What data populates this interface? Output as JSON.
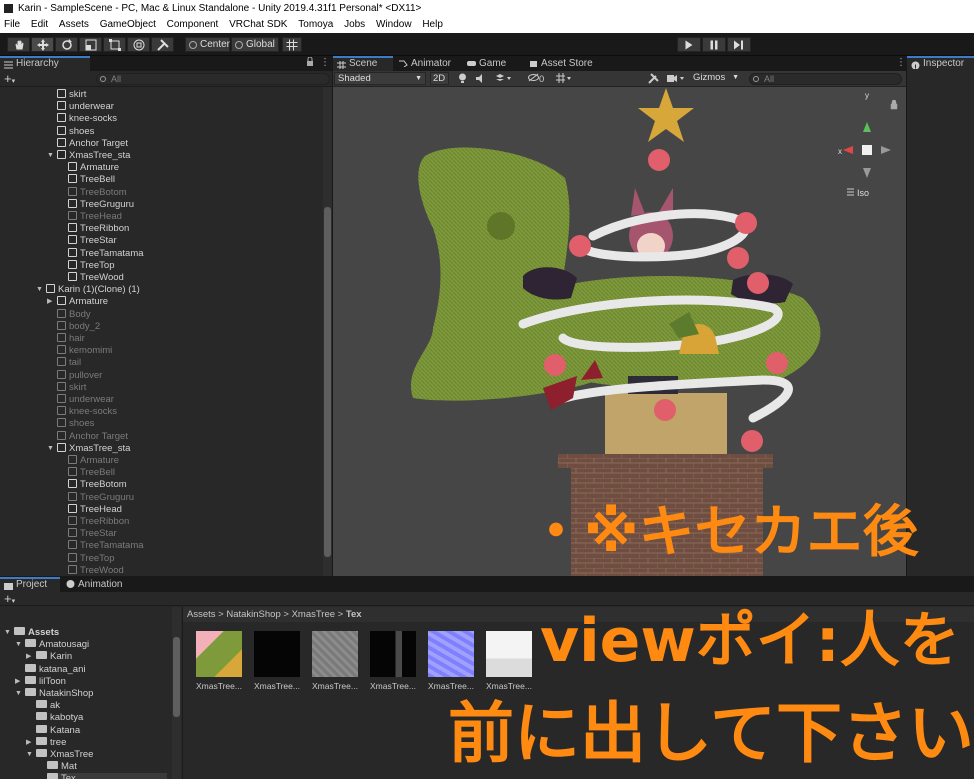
{
  "window": {
    "title": "Karin - SampleScene - PC, Mac & Linux Standalone - Unity 2019.4.31f1 Personal* <DX11>"
  },
  "menu": [
    "File",
    "Edit",
    "Assets",
    "GameObject",
    "Component",
    "VRChat SDK",
    "Tomoya",
    "Jobs",
    "Window",
    "Help"
  ],
  "toolbar": {
    "pivot": "Center",
    "space": "Global"
  },
  "hierarchy": {
    "tab": "Hierarchy",
    "search_placeholder": "All",
    "rows": [
      {
        "label": "skirt",
        "indent": 1,
        "dim": false,
        "arrow": ""
      },
      {
        "label": "underwear",
        "indent": 1,
        "dim": false,
        "arrow": ""
      },
      {
        "label": "knee-socks",
        "indent": 1,
        "dim": false,
        "arrow": ""
      },
      {
        "label": "shoes",
        "indent": 1,
        "dim": false,
        "arrow": ""
      },
      {
        "label": "Anchor Target",
        "indent": 1,
        "dim": false,
        "arrow": ""
      },
      {
        "label": "XmasTree_sta",
        "indent": 1,
        "dim": false,
        "arrow": "▼"
      },
      {
        "label": "Armature",
        "indent": 2,
        "dim": false,
        "arrow": ""
      },
      {
        "label": "TreeBell",
        "indent": 2,
        "dim": false,
        "arrow": ""
      },
      {
        "label": "TreeBotom",
        "indent": 2,
        "dim": true,
        "arrow": ""
      },
      {
        "label": "TreeGruguru",
        "indent": 2,
        "dim": false,
        "arrow": ""
      },
      {
        "label": "TreeHead",
        "indent": 2,
        "dim": true,
        "arrow": ""
      },
      {
        "label": "TreeRibbon",
        "indent": 2,
        "dim": false,
        "arrow": ""
      },
      {
        "label": "TreeStar",
        "indent": 2,
        "dim": false,
        "arrow": ""
      },
      {
        "label": "TreeTamatama",
        "indent": 2,
        "dim": false,
        "arrow": ""
      },
      {
        "label": "TreeTop",
        "indent": 2,
        "dim": false,
        "arrow": ""
      },
      {
        "label": "TreeWood",
        "indent": 2,
        "dim": false,
        "arrow": ""
      },
      {
        "label": "Karin (1)(Clone) (1)",
        "indent": 0,
        "dim": false,
        "arrow": "▼"
      },
      {
        "label": "Armature",
        "indent": 1,
        "dim": false,
        "arrow": "▶"
      },
      {
        "label": "Body",
        "indent": 1,
        "dim": true,
        "arrow": ""
      },
      {
        "label": "body_2",
        "indent": 1,
        "dim": true,
        "arrow": ""
      },
      {
        "label": "hair",
        "indent": 1,
        "dim": true,
        "arrow": ""
      },
      {
        "label": "kemomimi",
        "indent": 1,
        "dim": true,
        "arrow": ""
      },
      {
        "label": "tail",
        "indent": 1,
        "dim": true,
        "arrow": ""
      },
      {
        "label": "pullover",
        "indent": 1,
        "dim": true,
        "arrow": ""
      },
      {
        "label": "skirt",
        "indent": 1,
        "dim": true,
        "arrow": ""
      },
      {
        "label": "underwear",
        "indent": 1,
        "dim": true,
        "arrow": ""
      },
      {
        "label": "knee-socks",
        "indent": 1,
        "dim": true,
        "arrow": ""
      },
      {
        "label": "shoes",
        "indent": 1,
        "dim": true,
        "arrow": ""
      },
      {
        "label": "Anchor Target",
        "indent": 1,
        "dim": true,
        "arrow": ""
      },
      {
        "label": "XmasTree_sta",
        "indent": 1,
        "dim": false,
        "arrow": "▼"
      },
      {
        "label": "Armature",
        "indent": 2,
        "dim": true,
        "arrow": ""
      },
      {
        "label": "TreeBell",
        "indent": 2,
        "dim": true,
        "arrow": ""
      },
      {
        "label": "TreeBotom",
        "indent": 2,
        "dim": false,
        "arrow": ""
      },
      {
        "label": "TreeGruguru",
        "indent": 2,
        "dim": true,
        "arrow": ""
      },
      {
        "label": "TreeHead",
        "indent": 2,
        "dim": false,
        "arrow": ""
      },
      {
        "label": "TreeRibbon",
        "indent": 2,
        "dim": true,
        "arrow": ""
      },
      {
        "label": "TreeStar",
        "indent": 2,
        "dim": true,
        "arrow": ""
      },
      {
        "label": "TreeTamatama",
        "indent": 2,
        "dim": true,
        "arrow": ""
      },
      {
        "label": "TreeTop",
        "indent": 2,
        "dim": true,
        "arrow": ""
      },
      {
        "label": "TreeWood",
        "indent": 2,
        "dim": true,
        "arrow": ""
      }
    ]
  },
  "scene_tabs": [
    "Scene",
    "Animator",
    "Game",
    "Asset Store"
  ],
  "scene_toolbar": {
    "shading": "Shaded",
    "mode_2d": "2D",
    "hidden_count": "0",
    "gizmos": "Gizmos",
    "search_placeholder": "All",
    "projection": "Iso"
  },
  "inspector": {
    "tab": "Inspector"
  },
  "project": {
    "tabs": [
      "Project",
      "Animation"
    ],
    "breadcrumb": [
      "Assets",
      "NatakinShop",
      "XmasTree",
      "Tex"
    ],
    "tree": [
      {
        "label": "Assets",
        "indent": 0,
        "arrow": "▼",
        "bold": true
      },
      {
        "label": "Amatousagi",
        "indent": 1,
        "arrow": "▼",
        "bold": false
      },
      {
        "label": "Karin",
        "indent": 2,
        "arrow": "▶",
        "bold": false
      },
      {
        "label": "katana_ani",
        "indent": 1,
        "arrow": "",
        "bold": false
      },
      {
        "label": "lilToon",
        "indent": 1,
        "arrow": "▶",
        "bold": false
      },
      {
        "label": "NatakinShop",
        "indent": 1,
        "arrow": "▼",
        "bold": false
      },
      {
        "label": "ak",
        "indent": 2,
        "arrow": "",
        "bold": false
      },
      {
        "label": "kabotya",
        "indent": 2,
        "arrow": "",
        "bold": false
      },
      {
        "label": "Katana",
        "indent": 2,
        "arrow": "",
        "bold": false
      },
      {
        "label": "tree",
        "indent": 2,
        "arrow": "▶",
        "bold": false
      },
      {
        "label": "XmasTree",
        "indent": 2,
        "arrow": "▼",
        "bold": false
      },
      {
        "label": "Mat",
        "indent": 3,
        "arrow": "",
        "bold": false
      },
      {
        "label": "Tex",
        "indent": 3,
        "arrow": "",
        "bold": false
      }
    ],
    "assets": [
      {
        "label": "XmasTree...",
        "kind": "albedo"
      },
      {
        "label": "XmasTree...",
        "kind": "black"
      },
      {
        "label": "XmasTree...",
        "kind": "gray"
      },
      {
        "label": "XmasTree...",
        "kind": "dark"
      },
      {
        "label": "XmasTree...",
        "kind": "normal"
      },
      {
        "label": "XmasTree...",
        "kind": "white"
      }
    ]
  },
  "overlay": {
    "line1": "・※キセカエ後",
    "line2": "viewポイ:人を",
    "line3": "前に出して下さい"
  },
  "colors": {
    "accent": "#3d7bc8",
    "overlay": "#ff8a12",
    "tree_green": "#7e9a3a"
  }
}
